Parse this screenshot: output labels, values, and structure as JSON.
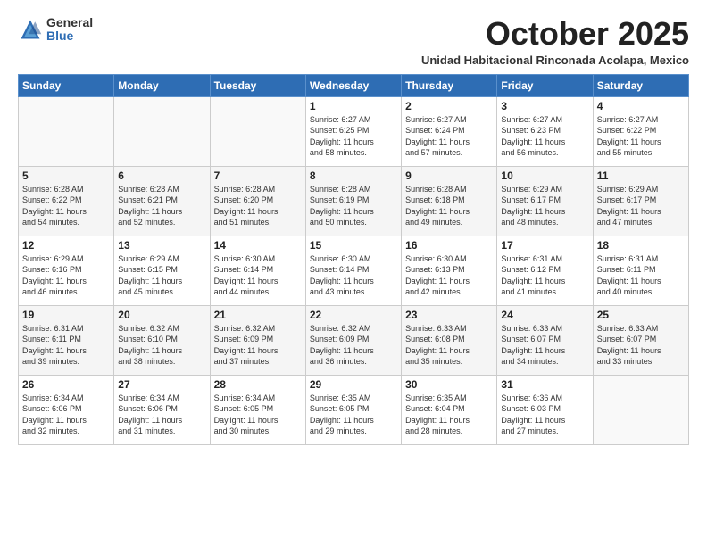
{
  "logo": {
    "general": "General",
    "blue": "Blue"
  },
  "header": {
    "month_title": "October 2025",
    "subtitle": "Unidad Habitacional Rinconada Acolapa, Mexico"
  },
  "days_of_week": [
    "Sunday",
    "Monday",
    "Tuesday",
    "Wednesday",
    "Thursday",
    "Friday",
    "Saturday"
  ],
  "weeks": [
    [
      {
        "day": "",
        "info": ""
      },
      {
        "day": "",
        "info": ""
      },
      {
        "day": "",
        "info": ""
      },
      {
        "day": "1",
        "info": "Sunrise: 6:27 AM\nSunset: 6:25 PM\nDaylight: 11 hours\nand 58 minutes."
      },
      {
        "day": "2",
        "info": "Sunrise: 6:27 AM\nSunset: 6:24 PM\nDaylight: 11 hours\nand 57 minutes."
      },
      {
        "day": "3",
        "info": "Sunrise: 6:27 AM\nSunset: 6:23 PM\nDaylight: 11 hours\nand 56 minutes."
      },
      {
        "day": "4",
        "info": "Sunrise: 6:27 AM\nSunset: 6:22 PM\nDaylight: 11 hours\nand 55 minutes."
      }
    ],
    [
      {
        "day": "5",
        "info": "Sunrise: 6:28 AM\nSunset: 6:22 PM\nDaylight: 11 hours\nand 54 minutes."
      },
      {
        "day": "6",
        "info": "Sunrise: 6:28 AM\nSunset: 6:21 PM\nDaylight: 11 hours\nand 52 minutes."
      },
      {
        "day": "7",
        "info": "Sunrise: 6:28 AM\nSunset: 6:20 PM\nDaylight: 11 hours\nand 51 minutes."
      },
      {
        "day": "8",
        "info": "Sunrise: 6:28 AM\nSunset: 6:19 PM\nDaylight: 11 hours\nand 50 minutes."
      },
      {
        "day": "9",
        "info": "Sunrise: 6:28 AM\nSunset: 6:18 PM\nDaylight: 11 hours\nand 49 minutes."
      },
      {
        "day": "10",
        "info": "Sunrise: 6:29 AM\nSunset: 6:17 PM\nDaylight: 11 hours\nand 48 minutes."
      },
      {
        "day": "11",
        "info": "Sunrise: 6:29 AM\nSunset: 6:17 PM\nDaylight: 11 hours\nand 47 minutes."
      }
    ],
    [
      {
        "day": "12",
        "info": "Sunrise: 6:29 AM\nSunset: 6:16 PM\nDaylight: 11 hours\nand 46 minutes."
      },
      {
        "day": "13",
        "info": "Sunrise: 6:29 AM\nSunset: 6:15 PM\nDaylight: 11 hours\nand 45 minutes."
      },
      {
        "day": "14",
        "info": "Sunrise: 6:30 AM\nSunset: 6:14 PM\nDaylight: 11 hours\nand 44 minutes."
      },
      {
        "day": "15",
        "info": "Sunrise: 6:30 AM\nSunset: 6:14 PM\nDaylight: 11 hours\nand 43 minutes."
      },
      {
        "day": "16",
        "info": "Sunrise: 6:30 AM\nSunset: 6:13 PM\nDaylight: 11 hours\nand 42 minutes."
      },
      {
        "day": "17",
        "info": "Sunrise: 6:31 AM\nSunset: 6:12 PM\nDaylight: 11 hours\nand 41 minutes."
      },
      {
        "day": "18",
        "info": "Sunrise: 6:31 AM\nSunset: 6:11 PM\nDaylight: 11 hours\nand 40 minutes."
      }
    ],
    [
      {
        "day": "19",
        "info": "Sunrise: 6:31 AM\nSunset: 6:11 PM\nDaylight: 11 hours\nand 39 minutes."
      },
      {
        "day": "20",
        "info": "Sunrise: 6:32 AM\nSunset: 6:10 PM\nDaylight: 11 hours\nand 38 minutes."
      },
      {
        "day": "21",
        "info": "Sunrise: 6:32 AM\nSunset: 6:09 PM\nDaylight: 11 hours\nand 37 minutes."
      },
      {
        "day": "22",
        "info": "Sunrise: 6:32 AM\nSunset: 6:09 PM\nDaylight: 11 hours\nand 36 minutes."
      },
      {
        "day": "23",
        "info": "Sunrise: 6:33 AM\nSunset: 6:08 PM\nDaylight: 11 hours\nand 35 minutes."
      },
      {
        "day": "24",
        "info": "Sunrise: 6:33 AM\nSunset: 6:07 PM\nDaylight: 11 hours\nand 34 minutes."
      },
      {
        "day": "25",
        "info": "Sunrise: 6:33 AM\nSunset: 6:07 PM\nDaylight: 11 hours\nand 33 minutes."
      }
    ],
    [
      {
        "day": "26",
        "info": "Sunrise: 6:34 AM\nSunset: 6:06 PM\nDaylight: 11 hours\nand 32 minutes."
      },
      {
        "day": "27",
        "info": "Sunrise: 6:34 AM\nSunset: 6:06 PM\nDaylight: 11 hours\nand 31 minutes."
      },
      {
        "day": "28",
        "info": "Sunrise: 6:34 AM\nSunset: 6:05 PM\nDaylight: 11 hours\nand 30 minutes."
      },
      {
        "day": "29",
        "info": "Sunrise: 6:35 AM\nSunset: 6:05 PM\nDaylight: 11 hours\nand 29 minutes."
      },
      {
        "day": "30",
        "info": "Sunrise: 6:35 AM\nSunset: 6:04 PM\nDaylight: 11 hours\nand 28 minutes."
      },
      {
        "day": "31",
        "info": "Sunrise: 6:36 AM\nSunset: 6:03 PM\nDaylight: 11 hours\nand 27 minutes."
      },
      {
        "day": "",
        "info": ""
      }
    ]
  ]
}
